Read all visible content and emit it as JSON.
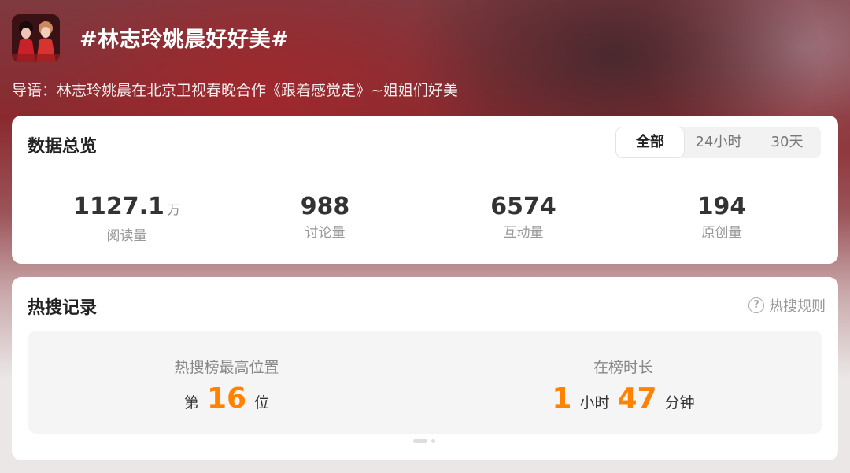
{
  "header": {
    "title": "#林志玲姚晨好好美#",
    "intro": "导语：林志玲姚晨在北京卫视春晚合作《跟着感觉走》~姐姐们好美"
  },
  "overview": {
    "title": "数据总览",
    "tabs": [
      "全部",
      "24小时",
      "30天"
    ],
    "selected_tab": "全部",
    "stats": [
      {
        "value": "1127.1",
        "unit": "万",
        "label": "阅读量"
      },
      {
        "value": "988",
        "unit": "",
        "label": "讨论量"
      },
      {
        "value": "6574",
        "unit": "",
        "label": "互动量"
      },
      {
        "value": "194",
        "unit": "",
        "label": "原创量"
      }
    ]
  },
  "hot_search": {
    "title": "热搜记录",
    "rule_label": "热搜规则",
    "rule_icon": "?",
    "peak": {
      "label": "热搜榜最高位置",
      "prefix": "第",
      "value": "16",
      "suffix": "位"
    },
    "duration": {
      "label": "在榜时长",
      "hours": "1",
      "hours_unit": "小时",
      "minutes": "47",
      "minutes_unit": "分钟"
    }
  },
  "colors": {
    "accent": "#ff8200",
    "text_primary": "#333333",
    "text_secondary": "#999999"
  }
}
